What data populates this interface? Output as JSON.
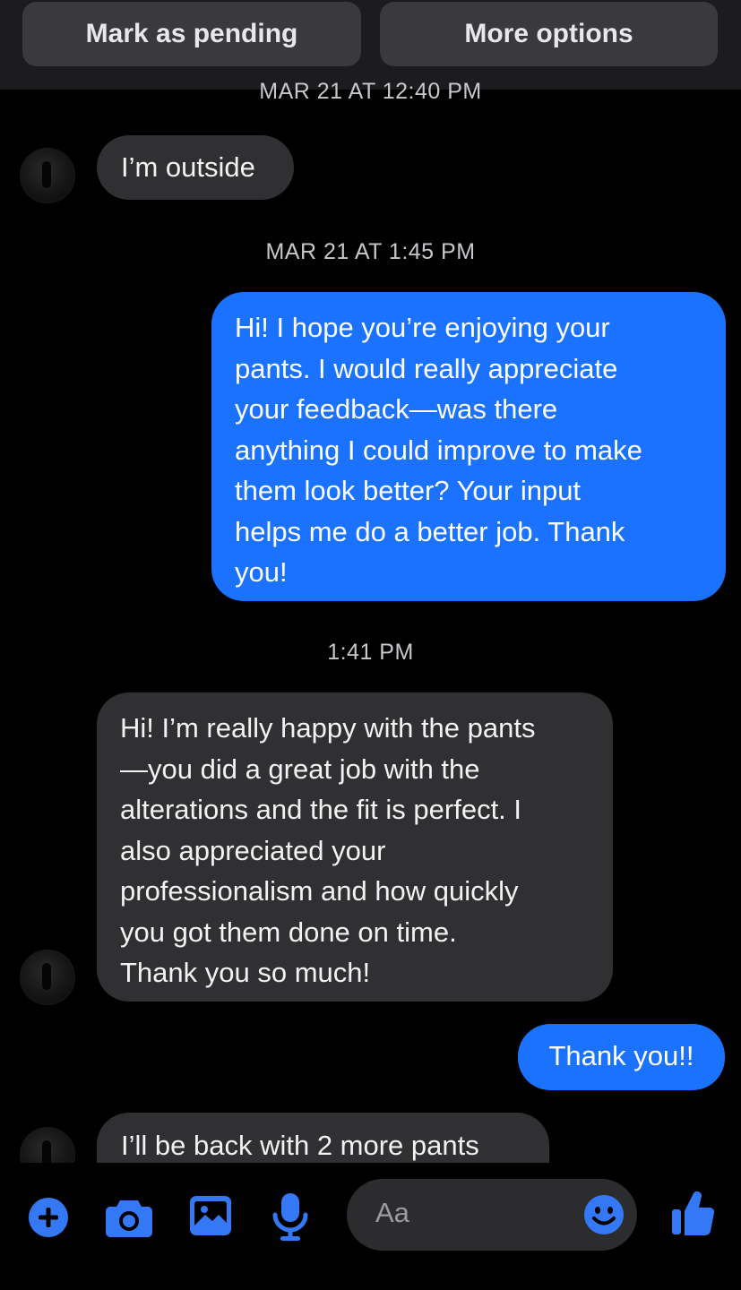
{
  "top_actions": {
    "mark_pending": "Mark as pending",
    "more_options": "More options"
  },
  "timestamps": {
    "t1": "MAR 21 AT 12:40 PM",
    "t2": "MAR 21 AT 1:45 PM",
    "t3": "1:41 PM"
  },
  "messages": [
    {
      "direction": "incoming",
      "text": "I’m outside"
    },
    {
      "direction": "outgoing",
      "text": "Hi! I hope you’re enjoying your\npants. I would really appreciate\nyour feedback—was there\nanything I could improve to make\nthem look better? Your input\nhelps me do a better job. Thank\nyou!"
    },
    {
      "direction": "incoming",
      "text": "Hi! I’m really happy with the pants\n—you did a great job with the\nalterations and the fit is perfect. I\nalso appreciated your\nprofessionalism and how quickly\nyou got them done on time.\nThank you so much!"
    },
    {
      "direction": "outgoing",
      "text": "Thank you!!"
    },
    {
      "direction": "incoming",
      "text": "I’ll be back with 2 more pants"
    }
  ],
  "composer": {
    "placeholder": "Aa",
    "icons": [
      "plus-icon",
      "camera-icon",
      "image-icon",
      "microphone-icon",
      "emoji-icon",
      "thumbs-up-icon"
    ]
  },
  "colors": {
    "accent": "#1a72ff",
    "icon_blue": "#3478f6",
    "incoming_bubble": "#303033",
    "background": "#000000"
  }
}
